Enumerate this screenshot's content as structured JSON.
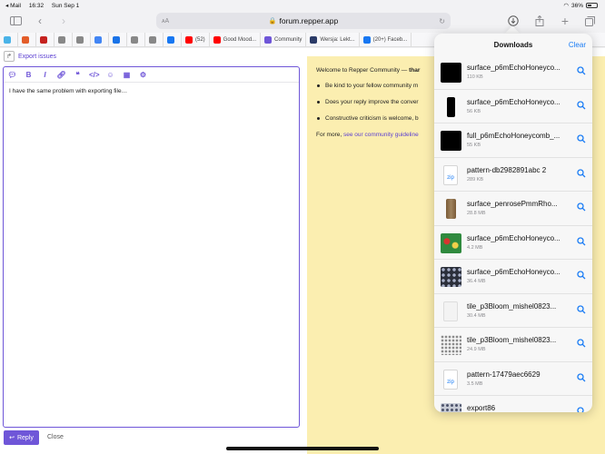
{
  "status": {
    "carrier": "◂ Mail",
    "time": "16:32",
    "date": "Sun Sep 1",
    "battery": "36%"
  },
  "toolbar": {
    "text_size": "ᴀA",
    "url": "forum.repper.app"
  },
  "bookmarks": [
    {
      "label": "",
      "color": "#4ab3e8"
    },
    {
      "label": "",
      "color": "#e35d2a"
    },
    {
      "label": "",
      "color": "#c5221f"
    },
    {
      "label": "",
      "color": "#888888"
    },
    {
      "label": "",
      "color": "#888888"
    },
    {
      "label": "",
      "color": "#4285f4"
    },
    {
      "label": "",
      "color": "#1a73e8"
    },
    {
      "label": "",
      "color": "#888888"
    },
    {
      "label": "",
      "color": "#888888"
    },
    {
      "label": "",
      "color": "#1877f2"
    },
    {
      "label": "(52)",
      "color": "#ff0000"
    },
    {
      "label": "Good Mood...",
      "color": "#ff0000"
    },
    {
      "label": "Community",
      "color": "#6f56d8"
    },
    {
      "label": "Wersja: Lekt...",
      "color": "#2b3a67"
    },
    {
      "label": "(20+) Faceb...",
      "color": "#1877f2"
    }
  ],
  "forum": {
    "export_link": "Export issues",
    "composer_text": "I have the same problem with exporting file…",
    "reply_label": "Reply",
    "close_label": "Close"
  },
  "preview": {
    "welcome_lead": "Welcome to Repper Community — ",
    "welcome_bold": "thar",
    "bullets": [
      "Be kind to your fellow community m",
      "Does your reply improve the conver",
      "Constructive criticism is welcome, b"
    ],
    "more_lead": "For more, ",
    "more_link": "see our community guideline"
  },
  "downloads": {
    "title": "Downloads",
    "clear_label": "Clear",
    "items": [
      {
        "name": "surface_p6mEchoHoneyco...",
        "size": "110 KB",
        "thumb": "black",
        "color": "#000000"
      },
      {
        "name": "surface_p6mEchoHoneyco...",
        "size": "56 KB",
        "thumb": "black-narrow",
        "color": "#000000"
      },
      {
        "name": "full_p6mEchoHoneycomb_...",
        "size": "55 KB",
        "thumb": "black",
        "color": "#000000"
      },
      {
        "name": "pattern-db2982891abc 2",
        "size": "289 KB",
        "thumb": "zip",
        "color": "#ffffff"
      },
      {
        "name": "surface_penrosePmmRho...",
        "size": "28.8 MB",
        "thumb": "wood",
        "color": "#8b6b45"
      },
      {
        "name": "surface_p6mEchoHoneyco...",
        "size": "4.2 MB",
        "thumb": "floral",
        "color": "#2f8a3e"
      },
      {
        "name": "surface_p6mEchoHoneyco...",
        "size": "36.4 MB",
        "thumb": "dots",
        "color": "#2b2f3a"
      },
      {
        "name": "tile_p3Bloom_mishel0823...",
        "size": "30.4 MB",
        "thumb": "blank",
        "color": "#f3f3f3"
      },
      {
        "name": "tile_p3Bloom_mishel0823...",
        "size": "24.9 MB",
        "thumb": "lace",
        "color": "#d9d9d9"
      },
      {
        "name": "pattern-17479aec6629",
        "size": "3.5 MB",
        "thumb": "zip",
        "color": "#ffffff"
      },
      {
        "name": "export86",
        "size": "12 KB",
        "thumb": "dots-light",
        "color": "#c8ccd6"
      }
    ]
  },
  "colors": {
    "accent": "#6f56d8",
    "link_blue": "#1a7cf5",
    "preview_bg": "#fbeeb0"
  }
}
